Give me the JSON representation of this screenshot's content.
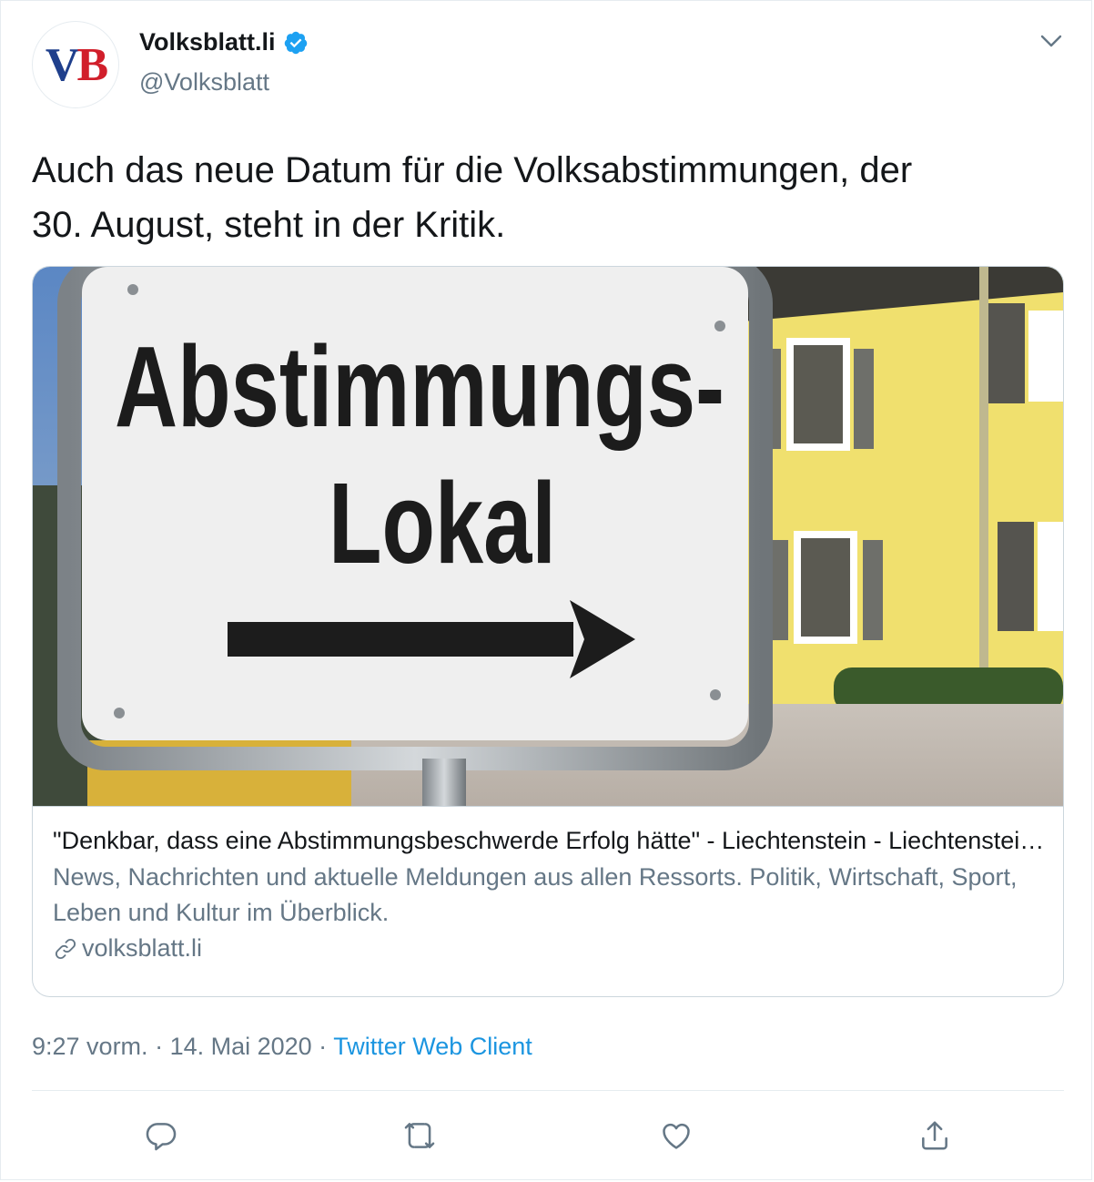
{
  "account": {
    "avatar_text_v": "V",
    "avatar_text_b": "B",
    "display_name": "Volksblatt.li",
    "handle": "@Volksblatt"
  },
  "tweet": {
    "text_line1": "Auch das neue Datum für die Volksabstimmungen, der",
    "text_line2": "30. August, steht in der Kritik."
  },
  "card": {
    "image_sign_line1": "Abstimmungs-",
    "image_sign_line2": "Lokal",
    "title": "\"Denkbar, dass eine Abstimmungsbeschwerde Erfolg hätte\" - Liechtenstein - Liechtensteiner Volksblatt",
    "description": "News, Nachrichten und aktuelle Meldungen aus allen Ressorts. Politik, Wirtschaft, Sport, Leben und Kultur im Überblick.",
    "domain": "volksblatt.li"
  },
  "meta": {
    "time": "9:27 vorm.",
    "separator1": " · ",
    "date": "14. Mai 2020",
    "separator2": " · ",
    "client": "Twitter Web Client"
  },
  "icons": {
    "verified": "verified-badge-icon",
    "caret": "chevron-down-icon",
    "link": "link-icon",
    "reply": "reply-icon",
    "retweet": "retweet-icon",
    "like": "heart-icon",
    "share": "share-icon"
  },
  "colors": {
    "accent": "#1da1f2",
    "link": "#1b95e0",
    "secondary_text": "#657786",
    "border": "#ccd6dd"
  }
}
